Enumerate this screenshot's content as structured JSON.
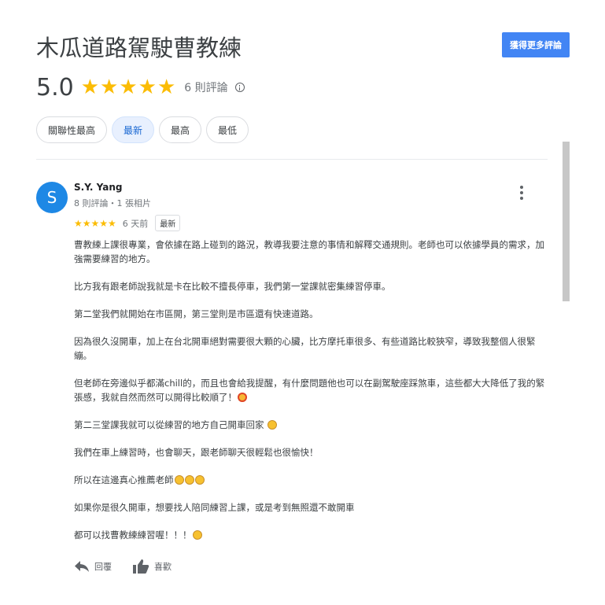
{
  "header": {
    "title": "木瓜道路駕駛曹教練",
    "get_more_reviews_label": "獲得更多評論"
  },
  "rating": {
    "score": "5.0",
    "stars": "★★★★★",
    "review_count": "6 則評論",
    "star_color": "#fbbc04"
  },
  "sort": {
    "options": [
      "關聯性最高",
      "最新",
      "最高",
      "最低"
    ],
    "selected": "最新"
  },
  "review": {
    "avatar_letter": "S",
    "avatar_color": "#1e88e5",
    "author": "S.Y. Yang",
    "author_meta": "8 則評論・1 張相片",
    "stars": "★★★★★",
    "time": "6 天前",
    "badge": "最新",
    "paragraphs": [
      "曹教練上課很專業，會依據在路上碰到的路況，教導我要注意的事情和解釋交通規則。老師也可以依據學員的需求，加強需要練習的地方。",
      "比方我有跟老師說我就是卡在比較不擅長停車，我們第一堂課就密集練習停車。",
      "第二堂我們就開始在市區開，第三堂則是市區還有快速道路。",
      "因為很久沒開車，加上在台北開車絕對需要很大顆的心臟，比方摩托車很多、有些道路比較狹窄，導致我整個人很緊繃。",
      "但老師在旁邊似乎都滿chill的，而且也會給我提醒，有什麼問題他也可以在副駕駛座踩煞車，這些都大大降低了我的緊張感，我就自然而然可以開得比較順了！",
      "第二三堂課我就可以從練習的地方自己開車回家",
      "我們在車上練習時，也會聊天，跟老師聊天很輕鬆也很愉快！",
      "所以在這邊真心推薦老師",
      "如果你是很久開車，想要找人陪同練習上課，或是考到無照還不敢開車",
      "都可以找曹教練練習喔！！！"
    ],
    "actions": {
      "reply_label": "回覆",
      "like_label": "喜歡"
    }
  },
  "icons": {
    "info": "info-icon",
    "more": "more-vert-icon",
    "reply": "reply-arrow-icon",
    "like": "thumbs-up-icon"
  }
}
